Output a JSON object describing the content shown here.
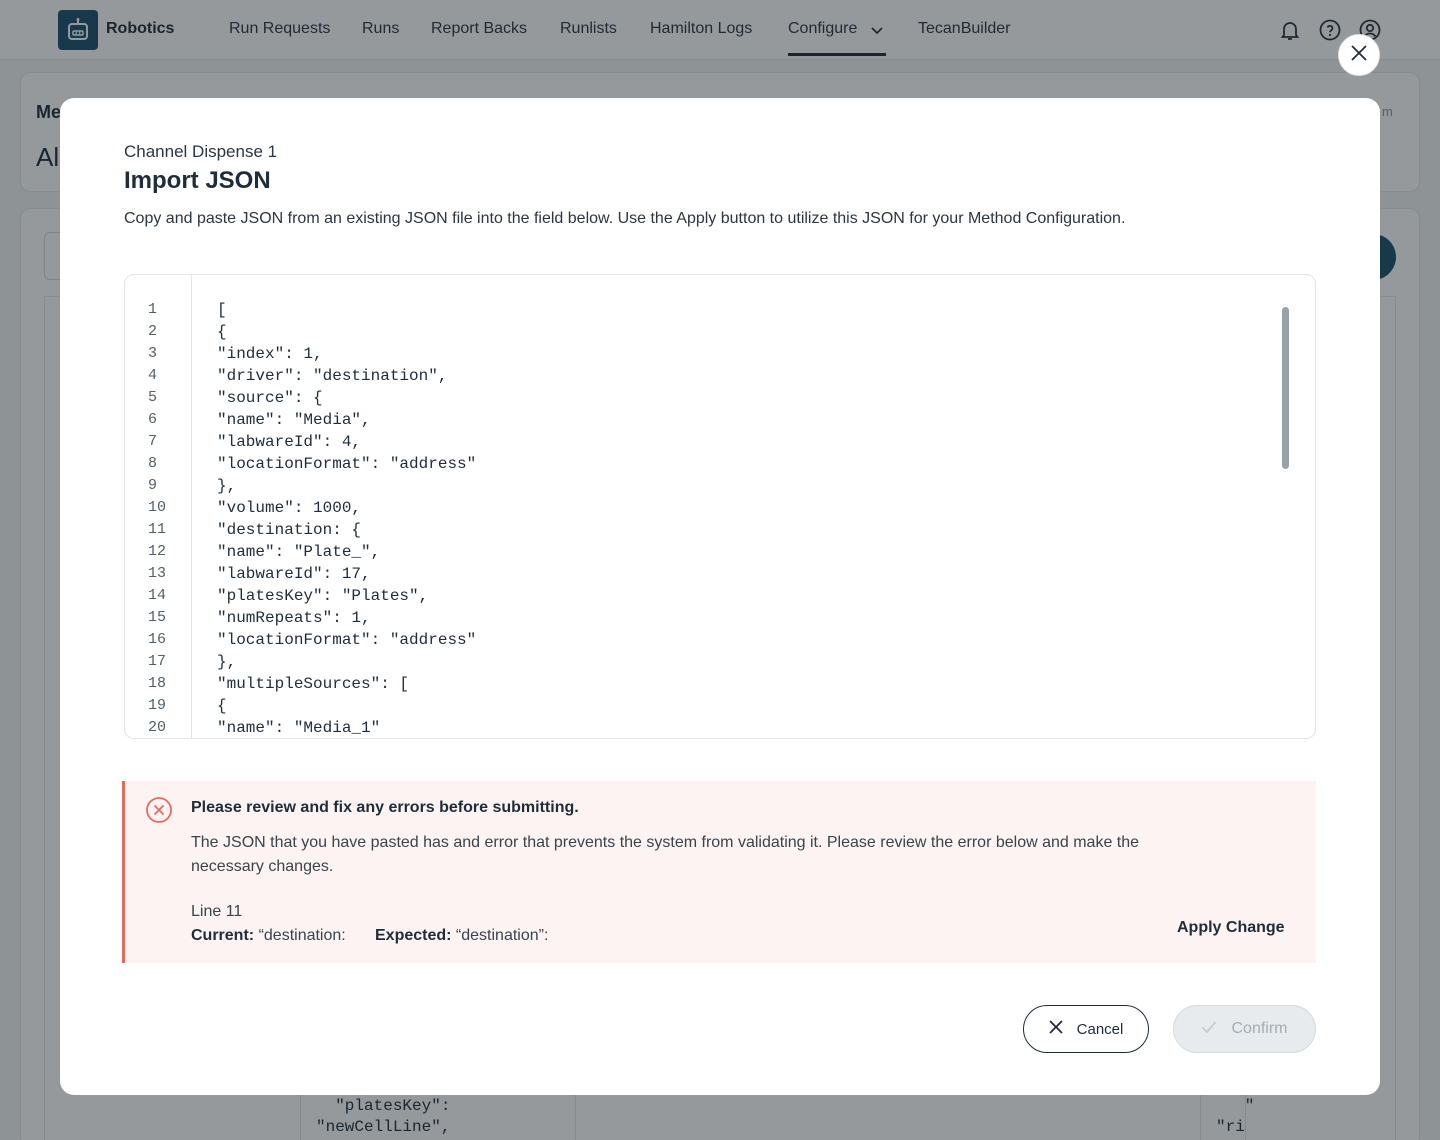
{
  "app": {
    "brand": "Robotics",
    "nav": [
      {
        "label": "Run Requests"
      },
      {
        "label": "Runs"
      },
      {
        "label": "Report Backs"
      },
      {
        "label": "Runlists"
      },
      {
        "label": "Hamilton Logs"
      },
      {
        "label": "Configure"
      },
      {
        "label": "TecanBuilder"
      }
    ],
    "active_nav": "Configure",
    "icons": [
      "bell-icon",
      "help-icon",
      "user-icon"
    ],
    "bg_partial": {
      "card_label": "Me",
      "card_heading": "Al",
      "card_right": "m",
      "table_fragment_1": "  \"platesKey\":\n\"newCellLine\",",
      "table_fragment_2": "   \"\n\"ri"
    }
  },
  "modal": {
    "subtitle": "Channel Dispense 1",
    "title": "Import JSON",
    "description": "Copy and paste JSON from an existing JSON file into the field below.  Use the Apply button to utilize this JSON for your Method Configuration.",
    "editor": {
      "line_numbers": [
        "1",
        "2",
        "3",
        "4",
        "5",
        "6",
        "7",
        "8",
        "9",
        "10",
        "11",
        "12",
        "13",
        "14",
        "15",
        "16",
        "17",
        "18",
        "19",
        "20"
      ],
      "lines": [
        "[",
        "{",
        "\"index\": 1,",
        "\"driver\": \"destination\",",
        "\"source\": {",
        "\"name\": \"Media\",",
        "\"labwareId\": 4,",
        "\"locationFormat\": \"address\"",
        "},",
        "\"volume\": 1000,",
        "\"destination: {",
        "\"name\": \"Plate_\",",
        "\"labwareId\": 17,",
        "\"platesKey\": \"Plates\",",
        "\"numRepeats\": 1,",
        "\"locationFormat\": \"address\"",
        "},",
        "\"multipleSources\": [",
        "{",
        "\"name\": \"Media_1\""
      ]
    },
    "error": {
      "title": "Please review and fix any errors before submitting.",
      "message": "The JSON that you have pasted has and error that prevents the system from validating it.  Please review the error below and make the necessary changes.",
      "line": "Line 11",
      "current_label": "Current:",
      "current_value": "“destination:",
      "expected_label": "Expected:",
      "expected_value": "“destination”:",
      "apply_label": "Apply Change",
      "color": "#e46b62"
    },
    "buttons": {
      "cancel": "Cancel",
      "confirm": "Confirm"
    }
  }
}
